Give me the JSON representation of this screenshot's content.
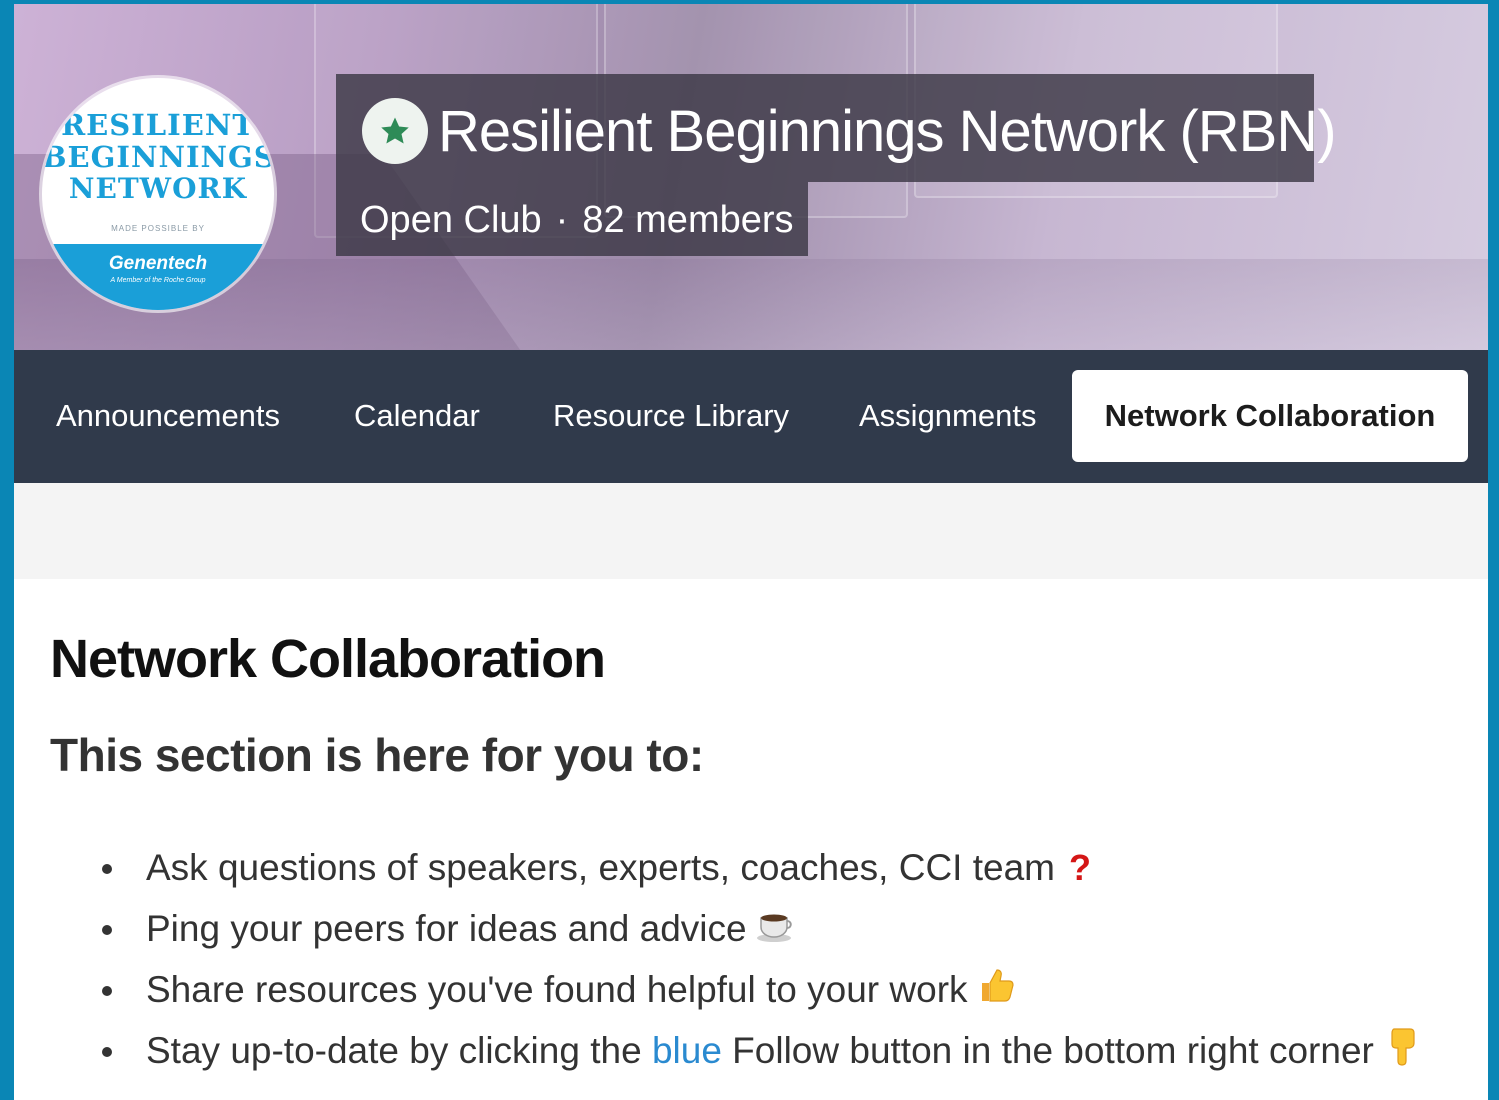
{
  "banner": {
    "logo": {
      "line1": "RESILIENT",
      "line2": "BEGINNINGS",
      "line3": "NETWORK",
      "small": "MADE POSSIBLE BY",
      "brand": "Genentech",
      "tagline": "A Member of the Roche Group"
    },
    "title": "Resilient Beginnings Network (RBN)",
    "club_type": "Open Club",
    "separator": "·",
    "members": "82 members",
    "icons": {
      "badge": "star-icon"
    },
    "colors": {
      "star": "#2e8b57",
      "logo_blue": "#1a9fd8"
    }
  },
  "nav": {
    "items": [
      {
        "label": "Announcements"
      },
      {
        "label": "Calendar"
      },
      {
        "label": "Resource Library"
      },
      {
        "label": "Assignments"
      },
      {
        "label": "Network Collaboration"
      }
    ],
    "active_index": 4
  },
  "content": {
    "heading": "Network Collaboration",
    "subheading": "This section is here for you to:",
    "bullets": [
      {
        "text": "Ask questions of speakers, experts, coaches, CCI team",
        "icon": "question-mark-icon",
        "glyph": "?"
      },
      {
        "text": "Ping your peers for ideas and advice",
        "icon": "coffee-icon"
      },
      {
        "text": "Share resources you've found helpful to your work",
        "icon": "thumbs-up-icon"
      },
      {
        "text_before": "Stay up-to-date by clicking the",
        "highlight": "blue",
        "text_after": "Follow button in the bottom right corner",
        "icon": "pointing-down-icon"
      }
    ],
    "colors": {
      "link_blue": "#2a8ad0",
      "question_red": "#d41616"
    }
  }
}
